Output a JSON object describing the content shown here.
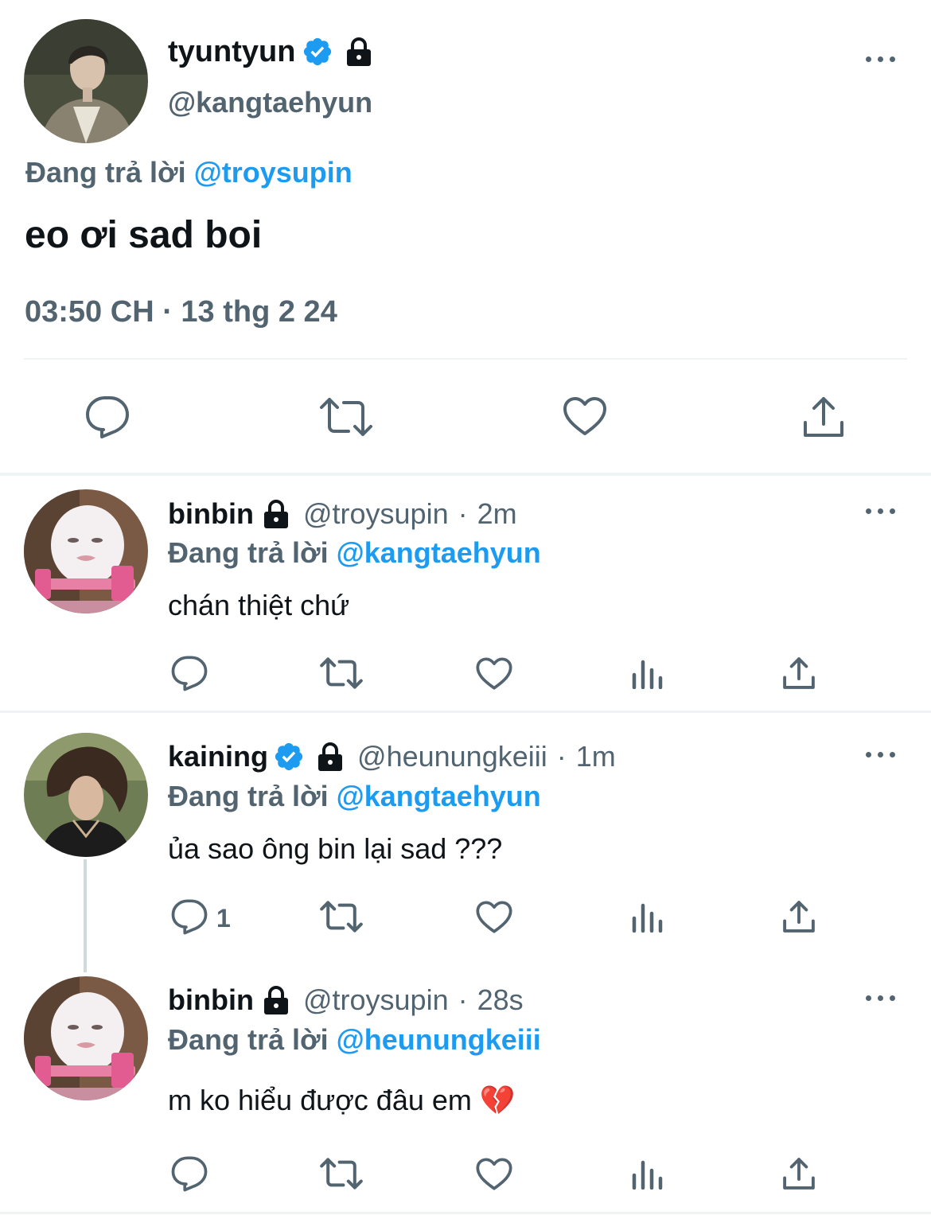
{
  "main_tweet": {
    "display_name": "tyuntyun",
    "handle": "@kangtaehyun",
    "replying_prefix": "Đang trả lời",
    "replying_to": "@troysupin",
    "text": "eo ơi sad boi",
    "timestamp": "03:50 CH · 13 thg 2 24"
  },
  "replies": [
    {
      "display_name": "binbin",
      "handle": "@troysupin",
      "sep": "·",
      "time": "2m",
      "replying_prefix": "Đang trả lời",
      "replying_to": "@kangtaehyun",
      "text": "chán thiệt chứ",
      "reply_count": ""
    },
    {
      "display_name": "kaining",
      "handle": "@heunungkeiii",
      "sep": "·",
      "time": "1m",
      "replying_prefix": "Đang trả lời",
      "replying_to": "@kangtaehyun",
      "text": "ủa sao ông bin lại sad ???",
      "reply_count": "1"
    },
    {
      "display_name": "binbin",
      "handle": "@troysupin",
      "sep": "·",
      "time": "28s",
      "replying_prefix": "Đang trả lời",
      "replying_to": "@heunungkeiii",
      "text": "m ko hiểu được đâu em",
      "emoji": "💔",
      "reply_count": ""
    }
  ],
  "icons": {
    "verified": "verified-badge-icon",
    "lock": "lock-icon",
    "more": "more-options-icon",
    "reply": "reply-icon",
    "retweet": "retweet-icon",
    "like": "like-icon",
    "views": "views-icon",
    "share": "share-icon"
  },
  "colors": {
    "accent": "#1d9bf0",
    "muted": "#536471",
    "text": "#0f1419",
    "divider": "#eff3f4"
  }
}
